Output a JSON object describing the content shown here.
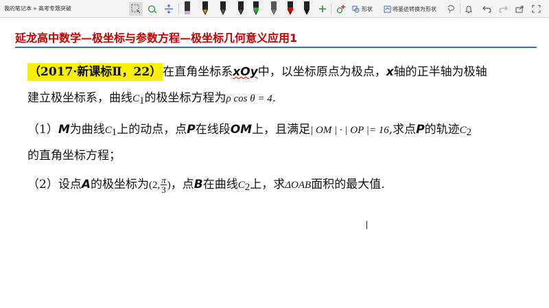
{
  "toolbar": {
    "breadcrumb": "我的笔记本 » 高考专题突破",
    "shape_label": "形状",
    "convert_label": "将墨迹转换为形状",
    "pen_colors": [
      "#111111",
      "#e0a000",
      "#111111",
      "#111111",
      "#2eaa2e",
      "#7a7a7a",
      "#d40000",
      "#111111"
    ],
    "highlighter_color": "#d8a6d8",
    "accent": "#3a6fb5"
  },
  "document": {
    "title": "延龙高中数学—极坐标与参数方程—极坐标几何意义应用1",
    "intro": {
      "source": "（2017·新课标Ⅱ，22）",
      "t1": "在直角坐标系",
      "xoy": "xOy",
      "t2": "中，以坐标原点为极点，",
      "x": "x",
      "t3": "轴的正半轴为极轴"
    },
    "line2": {
      "t1": "建立极坐标系，曲线",
      "c": "C",
      "c_sub": "1",
      "t2": "的极坐标方程为",
      "eq": "ρ cos θ = 4",
      "end": "."
    },
    "q1": {
      "num": "（1）",
      "M": "M",
      "t1": "为曲线",
      "c": "C",
      "c_sub": "1",
      "t2": "上的动点，点",
      "P": "P",
      "t3": "在线段",
      "OM": "OM",
      "t4": "上，且满足",
      "eq": "| OM | · | OP |= 16",
      "t5": ",求点",
      "P2": "P",
      "t6": "的轨迹",
      "c2": "C",
      "c2_sub": "2"
    },
    "q1_cont": "的直角坐标方程；",
    "q2": {
      "num": "（2）",
      "t1": "设点",
      "A": "A",
      "t2": "的极坐标为",
      "coord_open": "(2,",
      "frac_num": "π",
      "frac_den": "3",
      "coord_close": ")",
      "t3": "，点",
      "B": "B",
      "t4": "在曲线",
      "c": "C",
      "c_sub": "2",
      "t5": "上，求",
      "tri": "ΔOAB",
      "t6": "面积的最大值."
    }
  }
}
